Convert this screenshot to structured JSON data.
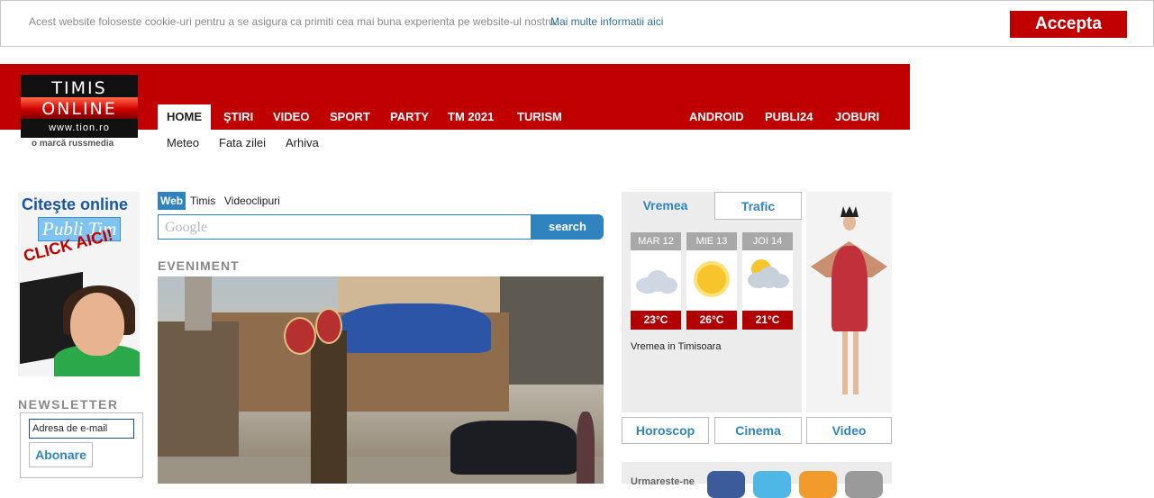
{
  "cookie": {
    "message": "Acest website foloseste cookie-uri pentru a se asigura ca primiti cea mai buna experienta pe website-ul nostru.",
    "more_link": "Mai multe informatii aici",
    "accept": "Accepta"
  },
  "logo": {
    "line1": "TIMIS",
    "line2": "ONLINE",
    "url": "www.tion.ro",
    "tagline": "o marcă russmedia"
  },
  "nav": {
    "items": [
      "HOME",
      "ŞTIRI",
      "VIDEO",
      "SPORT",
      "PARTY",
      "TM 2021",
      "TURISM"
    ],
    "right_items": [
      "ANDROID",
      "PUBLI24",
      "JOBURI"
    ],
    "sub_items": [
      "Meteo",
      "Fata zilei",
      "Arhiva"
    ]
  },
  "ad": {
    "line1": "Citeşte online",
    "line2": "Publi Tim",
    "line3": "CLICK AICI!"
  },
  "newsletter": {
    "heading": "NEWSLETTER",
    "email_value": "Adresa de e-mail",
    "subscribe": "Abonare"
  },
  "search": {
    "tabs": [
      "Web",
      "Timis",
      "Videoclipuri"
    ],
    "placeholder": "Google",
    "button": "search"
  },
  "section": {
    "heading": "EVENIMENT"
  },
  "weather": {
    "tabs": [
      "Vremea",
      "Trafic"
    ],
    "days": [
      {
        "label": "MAR 12",
        "temp": "23°C",
        "icon": "cloud-icon"
      },
      {
        "label": "MIE 13",
        "temp": "26°C",
        "icon": "sun-icon"
      },
      {
        "label": "JOI 14",
        "temp": "21°C",
        "icon": "storm-icon"
      }
    ],
    "city_text": "Vremea in Timisoara"
  },
  "links": {
    "buttons": [
      "Horoscop",
      "Cinema",
      "Video"
    ],
    "follow_label": "Urmareste-ne"
  },
  "colors": {
    "brand_red": "#c00000",
    "accent_blue": "#2f84bf"
  }
}
